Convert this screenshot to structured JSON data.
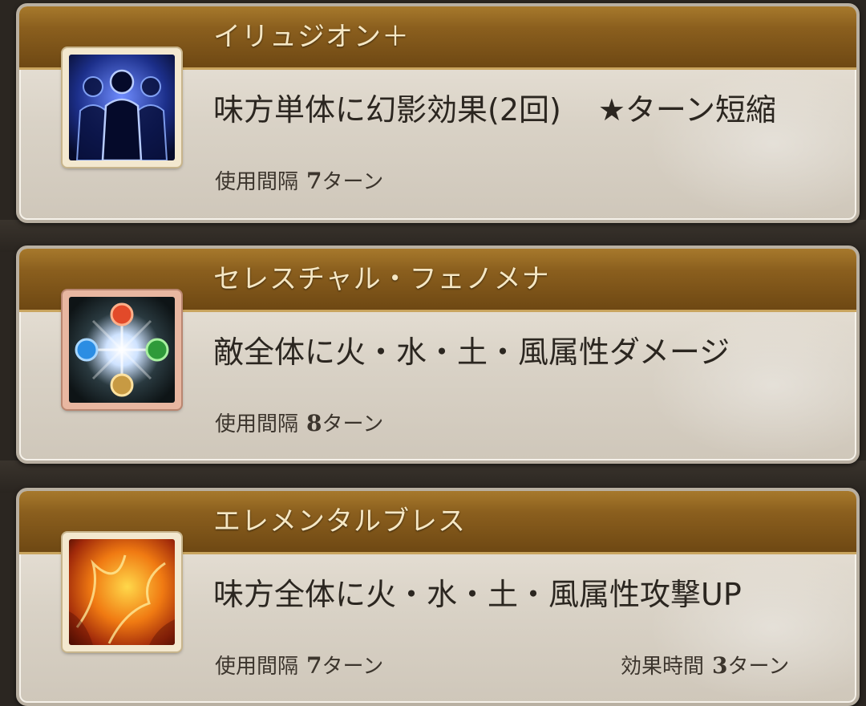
{
  "skills": [
    {
      "name": "イリュジオン＋",
      "description": "味方単体に幻影効果(2回)",
      "extra": "★ターン短縮",
      "cooldown_label": "使用間隔",
      "cooldown_value": "7",
      "cooldown_unit": "ターン",
      "icon": "shadow-clones-icon"
    },
    {
      "name": "セレスチャル・フェノメナ",
      "description": "敵全体に火・水・土・風属性ダメージ",
      "cooldown_label": "使用間隔",
      "cooldown_value": "8",
      "cooldown_unit": "ターン",
      "icon": "four-elements-icon"
    },
    {
      "name": "エレメンタルブレス",
      "description": "味方全体に火・水・土・風属性攻撃UP",
      "cooldown_label": "使用間隔",
      "cooldown_value": "7",
      "cooldown_unit": "ターン",
      "duration_label": "効果時間",
      "duration_value": "3",
      "duration_unit": "ターン",
      "icon": "flame-breath-icon"
    }
  ],
  "colors": {
    "header_gold": "#8b5f1e",
    "title_text": "#f5e7c4",
    "card_bg": "#e4ddd2",
    "body_text": "#2b2620",
    "page_bg": "#2b2621"
  }
}
